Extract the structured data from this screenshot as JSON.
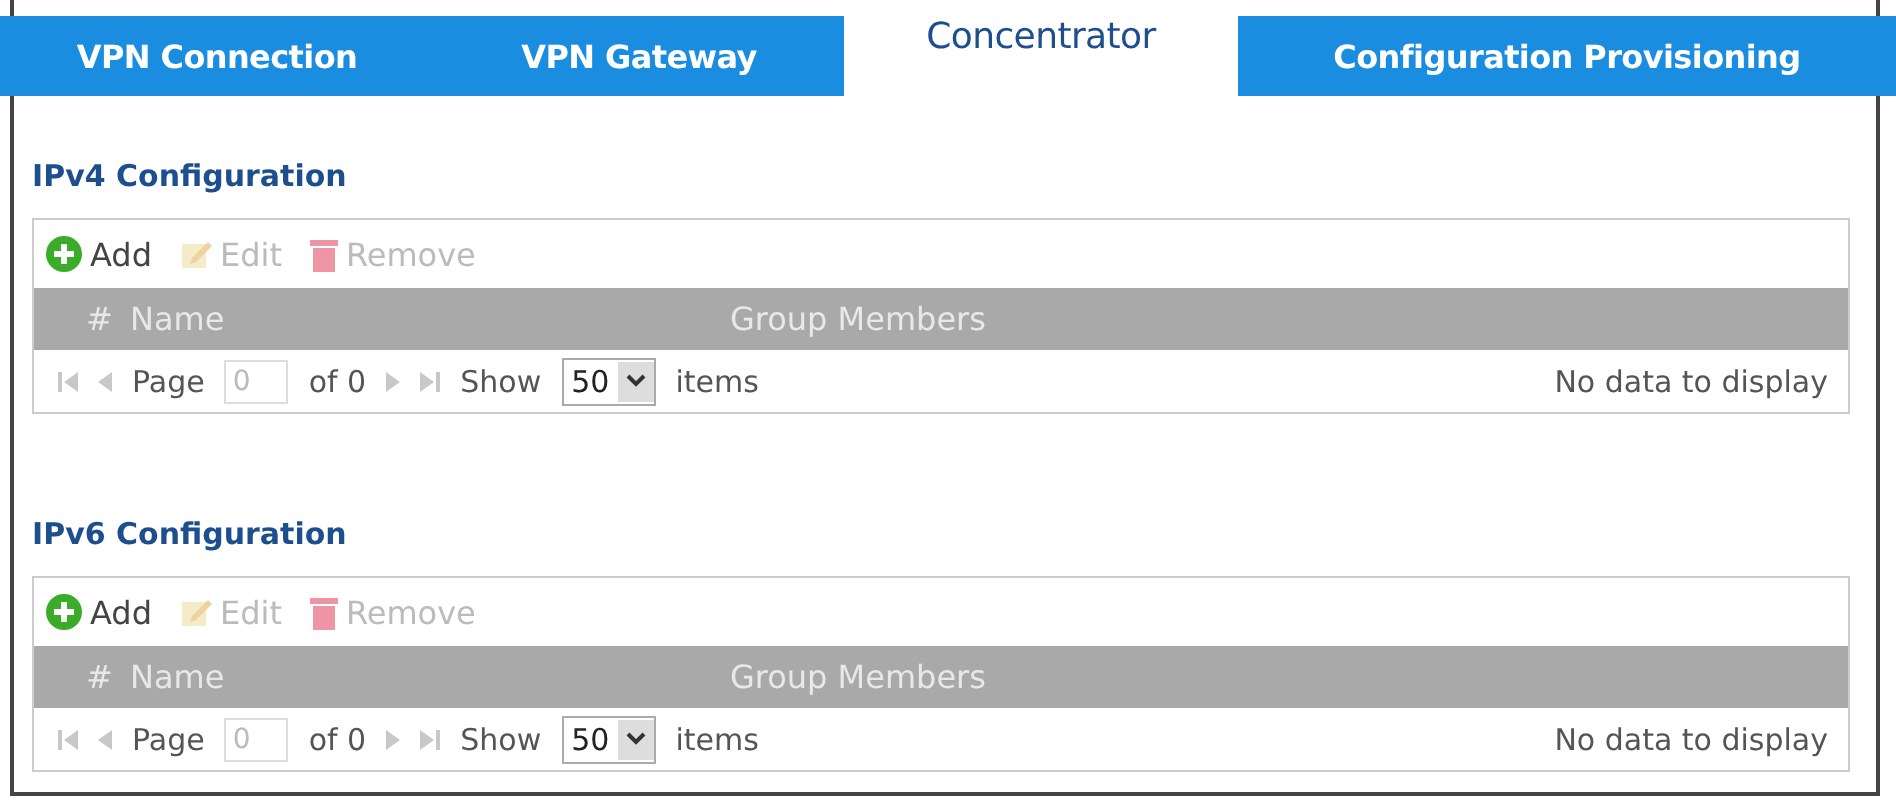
{
  "tabs": [
    {
      "label": "VPN Connection",
      "selected": false
    },
    {
      "label": "VPN Gateway",
      "selected": false
    },
    {
      "label": "Concentrator",
      "selected": true
    },
    {
      "label": "Configuration Provisioning",
      "selected": false
    }
  ],
  "sections": [
    {
      "title": "IPv4 Configuration",
      "toolbar": [
        {
          "kind": "add",
          "label": "Add",
          "disabled": false
        },
        {
          "kind": "edit",
          "label": "Edit",
          "disabled": true
        },
        {
          "kind": "remove",
          "label": "Remove",
          "disabled": true
        }
      ],
      "columns": [
        "#",
        "Name",
        "Group Members"
      ],
      "pager": {
        "page_label": "Page",
        "page": "0",
        "of": "of 0",
        "show_label": "Show",
        "per_page": "50",
        "items_label": "items",
        "status": "No data to display"
      }
    },
    {
      "title": "IPv6 Configuration",
      "toolbar": [
        {
          "kind": "add",
          "label": "Add",
          "disabled": false
        },
        {
          "kind": "edit",
          "label": "Edit",
          "disabled": true
        },
        {
          "kind": "remove",
          "label": "Remove",
          "disabled": true
        }
      ],
      "columns": [
        "#",
        "Name",
        "Group Members"
      ],
      "pager": {
        "page_label": "Page",
        "page": "0",
        "of": "of 0",
        "show_label": "Show",
        "per_page": "50",
        "items_label": "items",
        "status": "No data to display"
      }
    }
  ]
}
